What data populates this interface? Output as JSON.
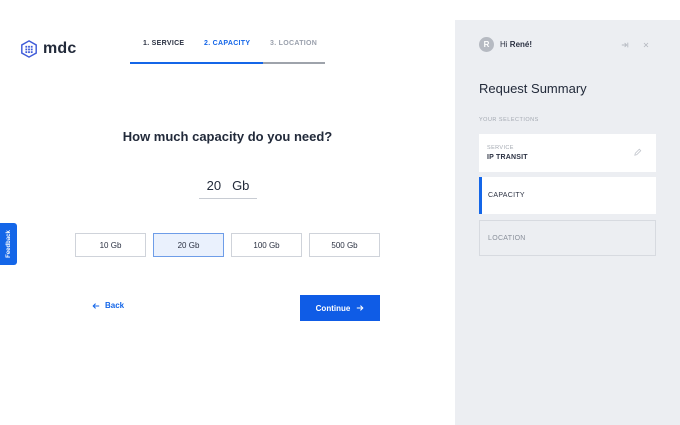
{
  "logo": {
    "text": "mdc",
    "icon": "hexagon-grid-icon",
    "color": "#3f5bd8"
  },
  "steps": [
    {
      "label": "1. SERVICE",
      "state": "done"
    },
    {
      "label": "2. CAPACITY",
      "state": "active"
    },
    {
      "label": "3. LOCATION",
      "state": "pending"
    }
  ],
  "progress": {
    "fraction": 0.68
  },
  "question": "How much capacity do you need?",
  "capacity": {
    "value": "20",
    "unit": "Gb"
  },
  "options": [
    {
      "label": "10 Gb",
      "selected": false
    },
    {
      "label": "20 Gb",
      "selected": true
    },
    {
      "label": "100 Gb",
      "selected": false
    },
    {
      "label": "500 Gb",
      "selected": false
    }
  ],
  "nav": {
    "back_label": "Back",
    "continue_label": "Continue"
  },
  "feedback_label": "Feedback",
  "summary": {
    "avatar_letter": "R",
    "greeting_prefix": "Hi",
    "user_name": "René!",
    "title": "Request Summary",
    "selections_label": "YOUR SELECTIONS",
    "service": {
      "label": "SERVICE",
      "value": "IP TRANSIT"
    },
    "capacity_label": "CAPACITY",
    "location_label": "LOCATION"
  },
  "colors": {
    "accent": "#1466e8",
    "panel_bg": "#eceef2"
  }
}
